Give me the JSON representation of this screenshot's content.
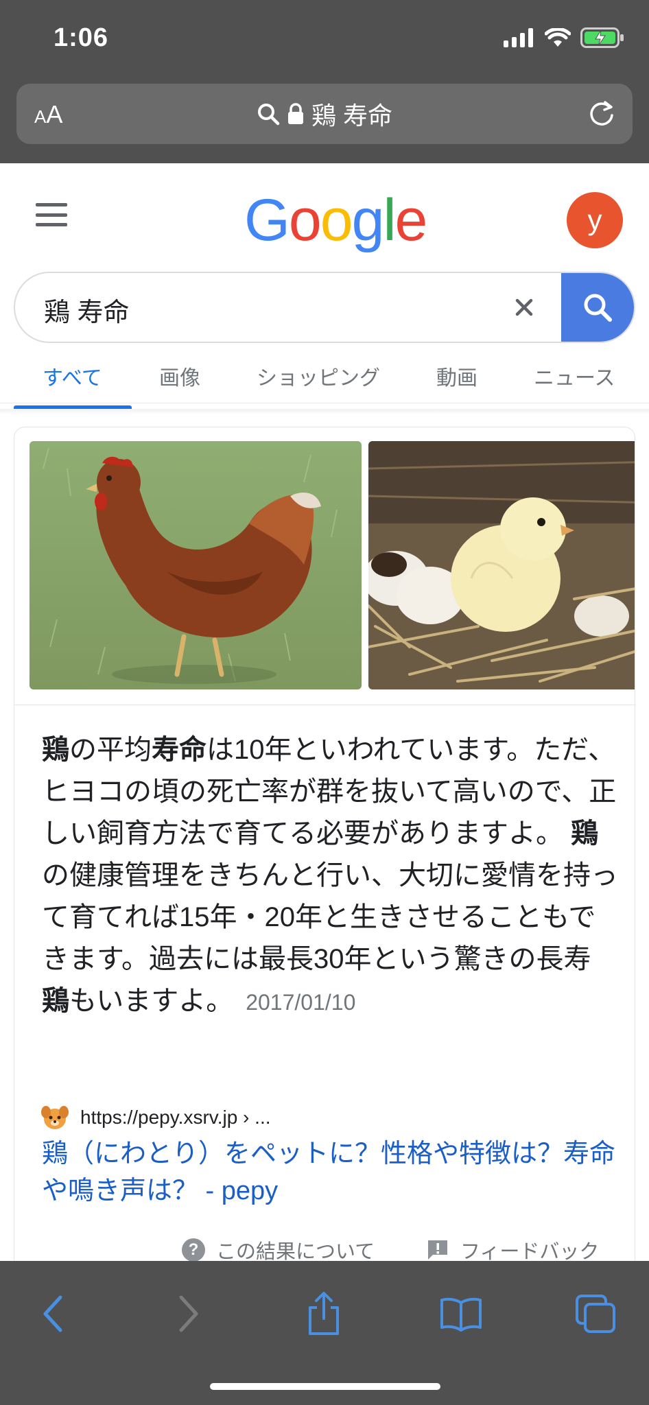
{
  "status": {
    "time": "1:06"
  },
  "browser": {
    "aa_small": "A",
    "aa_large": "A",
    "url_text": "鶏 寿命"
  },
  "google": {
    "logo": [
      "G",
      "o",
      "o",
      "g",
      "l",
      "e"
    ],
    "avatar_letter": "y",
    "search_value": "鶏 寿命",
    "tabs": [
      {
        "label": "すべて"
      },
      {
        "label": "画像"
      },
      {
        "label": "ショッピング"
      },
      {
        "label": "動画"
      },
      {
        "label": "ニュース"
      }
    ]
  },
  "result": {
    "snippet": {
      "s1_bold": "鶏",
      "s2": "の平均",
      "s3_bold": "寿命",
      "s4": "は10年といわれています。ただ、ヒヨコの頃の死亡率が群を抜いて高いので、正しい飼育方法で育てる必要がありますよ。 ",
      "s5_bold": "鶏",
      "s6": "の健康管理をきちんと行い、大切に愛情を持って育てれば15年・20年と生きさせることもできます。過去には最長30年という驚きの長寿",
      "s7_bold": "鶏",
      "s8": "もいますよ。",
      "date": "2017/01/10"
    },
    "source_url": "https://pepy.xsrv.jp › ...",
    "title": "鶏（にわとり）をペットに？性格や特徴は？寿命や鳴き声は？ - pepy",
    "about_label": "この結果について",
    "feedback_label": "フィードバック"
  },
  "colors": {
    "chrome_bg": "#505050",
    "link_blue": "#1a5ec7",
    "tab_active": "#1a73e8",
    "search_button": "#4a7be0",
    "avatar": "#e8542d",
    "toolbar_icon": "#4a90e2"
  },
  "icons": {
    "search": "search-icon",
    "lock": "lock-icon",
    "reload": "reload-icon",
    "clear": "close-icon",
    "back": "chevron-left-icon",
    "forward": "chevron-right-icon",
    "share": "share-icon",
    "bookmarks": "book-icon",
    "tabs": "tabs-icon"
  }
}
